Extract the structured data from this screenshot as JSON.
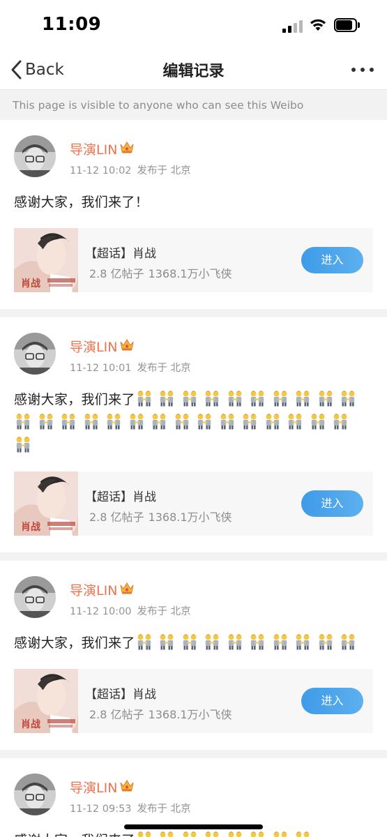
{
  "status_bar": {
    "time": "11:09"
  },
  "nav": {
    "back_label": "Back",
    "title": "编辑记录"
  },
  "notice": "This page is visible to anyone who can see this Weibo",
  "posts": [
    {
      "author": "导演LIN",
      "time": "11-12 10:02",
      "source": "发布于 北京",
      "text": "感谢大家，我们来了！",
      "emoji_count": 0,
      "card": {
        "title": "【超话】肖战",
        "posts": "2.8 亿帖子",
        "fans": "1368.1万小飞侠",
        "button": "进入"
      }
    },
    {
      "author": "导演LIN",
      "time": "11-12 10:01",
      "source": "发布于 北京",
      "text": "感谢大家，我们来了",
      "emoji_count": 26,
      "card": {
        "title": "【超话】肖战",
        "posts": "2.8 亿帖子",
        "fans": "1368.1万小飞侠",
        "button": "进入"
      }
    },
    {
      "author": "导演LIN",
      "time": "11-12 10:00",
      "source": "发布于 北京",
      "text": "感谢大家，我们来了",
      "emoji_count": 10,
      "card": {
        "title": "【超话】肖战",
        "posts": "2.8 亿帖子",
        "fans": "1368.1万小飞侠",
        "button": "进入"
      }
    },
    {
      "author": "导演LIN",
      "time": "11-12 09:53",
      "source": "发布于 北京",
      "text": "感谢大家，我们来了",
      "emoji_count": 8
    }
  ],
  "card_thumb_caption": "肖战",
  "colors": {
    "author": "#eb7350",
    "button": "#4aa4ea",
    "divider": "#f2f2f2"
  },
  "icons": {
    "back": "chevron-left-icon",
    "more": "ellipsis-icon",
    "vip": "crown-icon",
    "emoji": "people-holding-hands-emoji"
  }
}
